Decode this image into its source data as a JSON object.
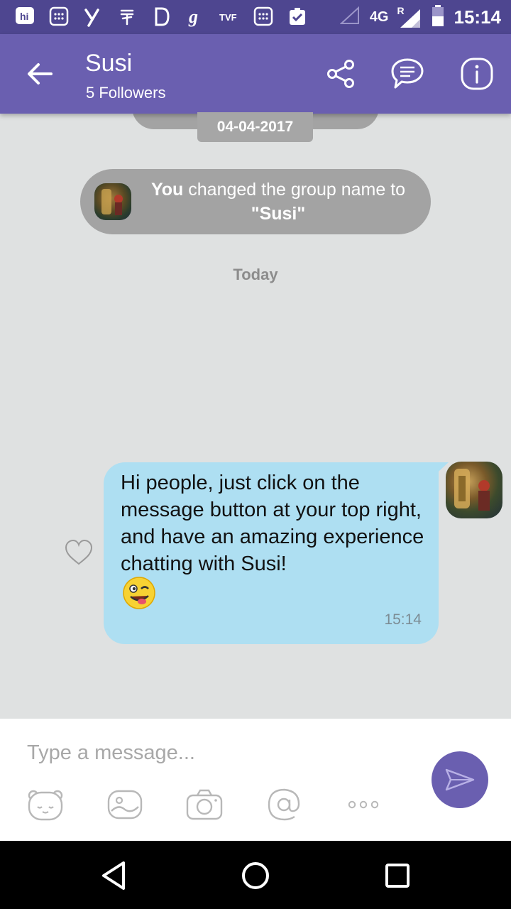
{
  "status_bar": {
    "network": "4G",
    "roaming": "R",
    "time": "15:14",
    "app_icons": [
      "hike-icon",
      "calculator-icon",
      "yatra-icon",
      "paytm-icon",
      "dailyhunt-icon",
      "gaana-icon",
      "tvf-icon",
      "calculator-icon",
      "task-check-icon"
    ]
  },
  "header": {
    "title": "Susi",
    "subtitle": "5 Followers"
  },
  "chat": {
    "date_chip": "04-04-2017",
    "system_message": {
      "actor": "You",
      "text_middle": " changed the group name to ",
      "group_name": "\"Susi\""
    },
    "today_label": "Today",
    "message": {
      "text": "Hi people, just click on the message button at your top right, and have an amazing experience chatting with Susi!",
      "emoji": "winking-face-tongue-emoji",
      "time": "15:14"
    }
  },
  "composer": {
    "placeholder": "Type a message..."
  },
  "colors": {
    "status_bar": "#4e4690",
    "app_bar": "#6a5fb0",
    "bubble": "#aedff2",
    "background": "#dfe1e1",
    "system_pill": "#a3a3a3"
  }
}
